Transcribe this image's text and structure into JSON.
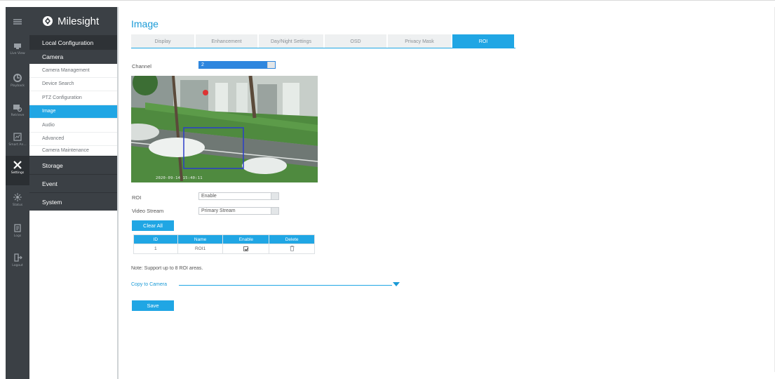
{
  "brand": {
    "name": "Milesight"
  },
  "rail": [
    {
      "label": "Live View",
      "icon": "live-view-icon"
    },
    {
      "label": "Playback",
      "icon": "playback-icon"
    },
    {
      "label": "Retrieve",
      "icon": "retrieve-icon"
    },
    {
      "label": "Smart An...",
      "icon": "smart-analysis-icon"
    },
    {
      "label": "Settings",
      "icon": "settings-icon"
    },
    {
      "label": "Status",
      "icon": "status-icon"
    },
    {
      "label": "Logs",
      "icon": "logs-icon"
    },
    {
      "label": "Logout",
      "icon": "logout-icon"
    }
  ],
  "nav": {
    "local_configuration": "Local Configuration",
    "camera": "Camera",
    "camera_items": [
      "Camera Management",
      "Device Search",
      "PTZ Configuration",
      "Image",
      "Audio",
      "Advanced",
      "Camera Maintenance"
    ],
    "storage": "Storage",
    "event": "Event",
    "system": "System"
  },
  "page": {
    "title": "Image",
    "tabs": [
      "Display",
      "Enhancement",
      "Day/Night Settings",
      "OSD",
      "Privacy Mask",
      "ROI"
    ],
    "channel_label": "Channel",
    "channel_value": "2",
    "video_osd": "2020-09-14 15:40:11",
    "roi_label": "ROI",
    "roi_value": "Enable",
    "video_stream_label": "Video Stream",
    "video_stream_value": "Primary Stream",
    "clear_all": "Clear All",
    "table": {
      "headers": [
        "ID",
        "Name",
        "Enable",
        "Delete"
      ],
      "rows": [
        {
          "id": "1",
          "name": "ROI1"
        }
      ]
    },
    "note": "Note: Support up to 8 ROI areas.",
    "copy_to_camera": "Copy to Camera",
    "save": "Save"
  },
  "colors": {
    "accent": "#20a6e4",
    "sidebar": "#3b4045",
    "title": "#1a9ad6"
  }
}
